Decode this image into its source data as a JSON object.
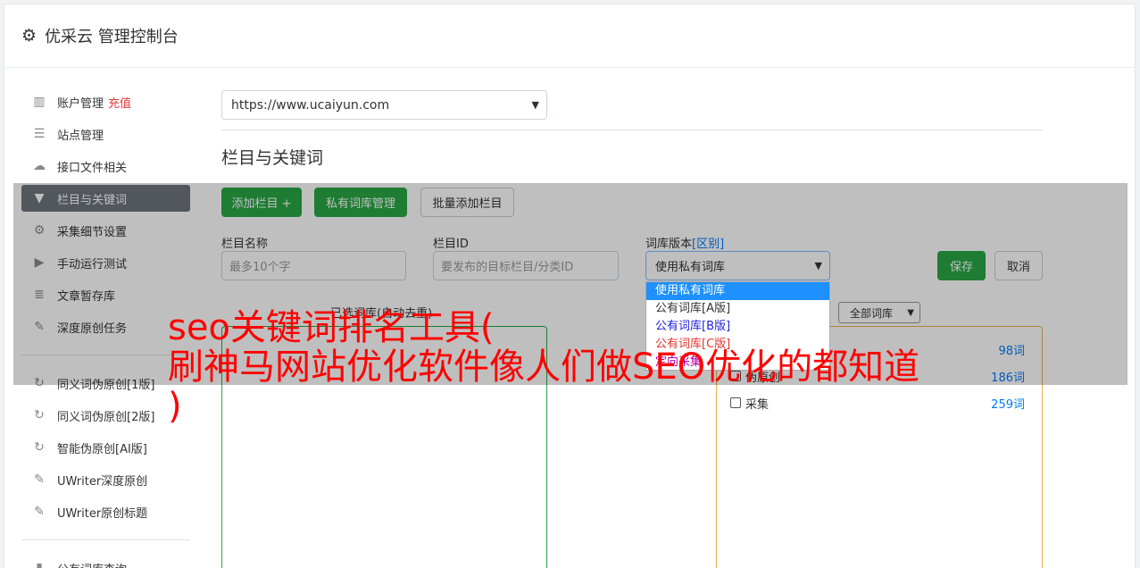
{
  "header": {
    "title": "优采云 管理控制台"
  },
  "sidebar": {
    "group1": [
      {
        "label": "账户管理",
        "extra": "充值",
        "icon": "bar-chart-icon"
      },
      {
        "label": "站点管理",
        "icon": "server-icon"
      },
      {
        "label": "接口文件相关",
        "icon": "cloud-upload-icon"
      },
      {
        "label": "栏目与关键词",
        "icon": "filter-icon",
        "active": true
      },
      {
        "label": "采集细节设置",
        "icon": "gears-icon"
      },
      {
        "label": "手动运行测试",
        "icon": "play-circle-icon"
      },
      {
        "label": "文章暂存库",
        "icon": "database-icon"
      },
      {
        "label": "深度原创任务",
        "icon": "edit-icon"
      }
    ],
    "group2": [
      {
        "label": "同义词伪原创[1版]",
        "icon": "refresh-icon"
      },
      {
        "label": "同义词伪原创[2版]",
        "icon": "refresh-icon"
      },
      {
        "label": "智能伪原创[AI版]",
        "icon": "refresh-icon"
      },
      {
        "label": "UWriter深度原创",
        "icon": "edit-icon"
      },
      {
        "label": "UWriter原创标题",
        "icon": "edit-icon"
      }
    ],
    "group3": [
      {
        "label": "公有词库查询",
        "icon": "book-icon"
      }
    ]
  },
  "site_select": {
    "value": "https://www.ucaiyun.com"
  },
  "section_title": "栏目与关键词",
  "buttons": {
    "add_column": "添加栏目 +",
    "private_lib": "私有词库管理",
    "batch_add": "批量添加栏目",
    "save": "保存",
    "cancel": "取消"
  },
  "form": {
    "name_label": "栏目名称",
    "name_placeholder": "最多10个字",
    "id_label": "栏目ID",
    "id_placeholder": "要发布的目标栏目/分类ID",
    "version_label": "词库版本",
    "version_link": "[区别]",
    "version_value": "使用私有词库"
  },
  "dropdown_options": [
    {
      "label": "使用私有词库",
      "selected": true
    },
    {
      "label": "公有词库[A版]"
    },
    {
      "label": "公有词库[B版]"
    },
    {
      "label": "公有词库[C版]"
    },
    {
      "label": "定向采集"
    }
  ],
  "selected_words_title": "已选词库(自动去重)",
  "filter_select": "全部词库",
  "libraries": [
    {
      "name": "...",
      "count": "98词"
    },
    {
      "name": "伪原创",
      "count": "186词"
    },
    {
      "name": "采集",
      "count": "259词"
    }
  ],
  "watermark": {
    "line1": "seo关键词排名工具(",
    "line2": "刷神马网站优化软件像人们做SEO优化的都知道",
    "line3": ")"
  }
}
